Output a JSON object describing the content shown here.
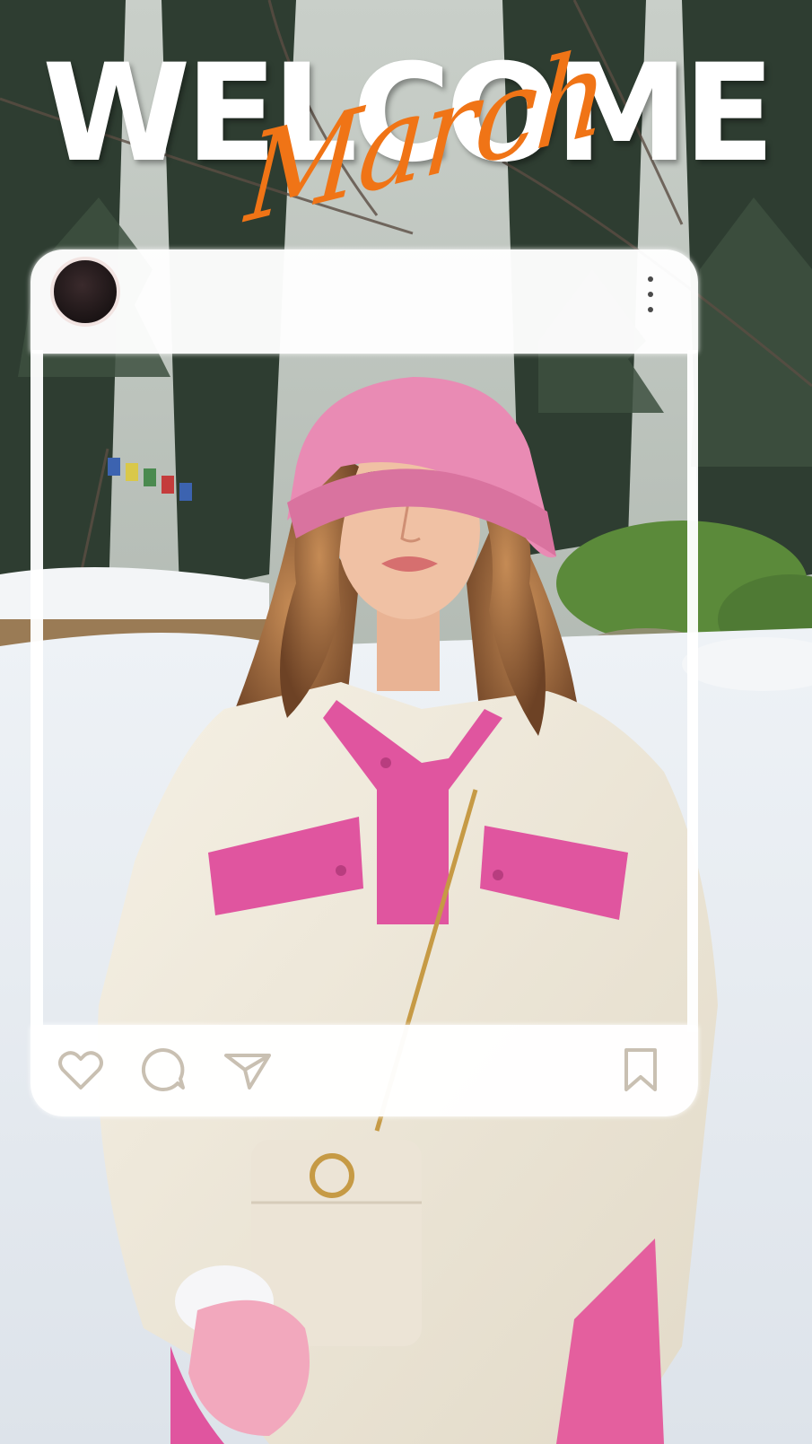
{
  "overlay": {
    "title": "WELCOME",
    "script": "March",
    "title_color": "#ffffff",
    "script_color": "#f07416"
  },
  "post_frame": {
    "header_icons": [
      "avatar",
      "more-vertical-icon"
    ],
    "action_icons": [
      "heart-icon",
      "comment-icon",
      "send-icon",
      "bookmark-icon"
    ]
  },
  "colors": {
    "frame": "#ffffff",
    "hat": "#e98bb4",
    "jacket": "#f1ebdc",
    "jacket_accent": "#e0559f",
    "snow": "#eef1f4",
    "trees": "#2b3a2f"
  }
}
